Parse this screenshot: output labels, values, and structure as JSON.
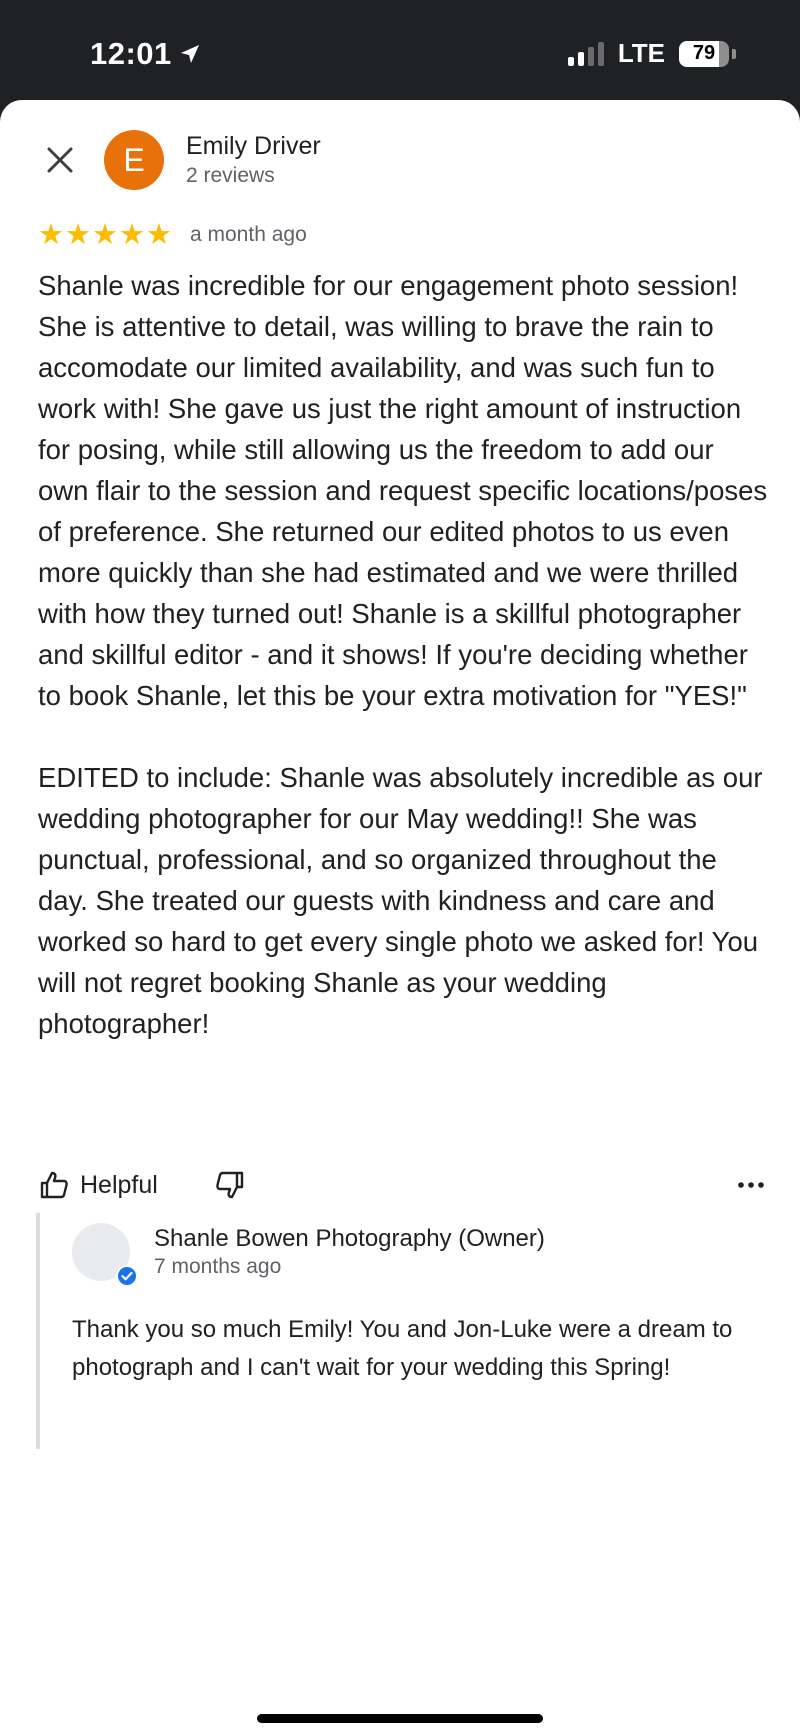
{
  "status_bar": {
    "time": "12:01",
    "network": "LTE",
    "battery_level": "79",
    "battery_fraction": 0.79
  },
  "review": {
    "close_icon": "close-icon",
    "avatar_initial": "E",
    "avatar_color": "#e8710a",
    "reviewer_name": "Emily Driver",
    "reviewer_meta": "2 reviews",
    "rating": 5,
    "star_color": "#fbbc04",
    "date": "a month ago",
    "body_paragraphs": [
      "Shanle was incredible for our engagement photo session! She is attentive to detail, was willing to brave the rain to accomodate our limited availability, and was such fun to work with! She gave us just the right amount of instruction for posing, while still allowing us the freedom to add our own flair to the session and request specific locations/poses of preference. She returned our edited photos to us even more quickly than she had estimated and we were thrilled with how they turned out! Shanle is a skillful photographer and skillful editor - and it shows! If you're deciding whether to book Shanle, let this be your extra motivation for \"YES!\"",
      "EDITED to include: Shanle was absolutely incredible as our wedding photographer for our May wedding!! She was punctual, professional, and so organized throughout the day. She treated our guests with kindness and care and worked so hard to get every single photo we asked for! You will not regret booking Shanle as your wedding photographer!"
    ]
  },
  "actions": {
    "helpful_label": "Helpful",
    "helpful_icon": "thumbs-up-icon",
    "not_helpful_icon": "thumbs-down-icon",
    "more_icon": "more-horizontal-icon"
  },
  "owner_reply": {
    "name": "Shanle Bowen Photography (Owner)",
    "date": "7 months ago",
    "verified_color": "#1a73e8",
    "text": "Thank you so much Emily! You and Jon-Luke were a dream to photograph and I can't wait for your wedding this Spring!"
  }
}
